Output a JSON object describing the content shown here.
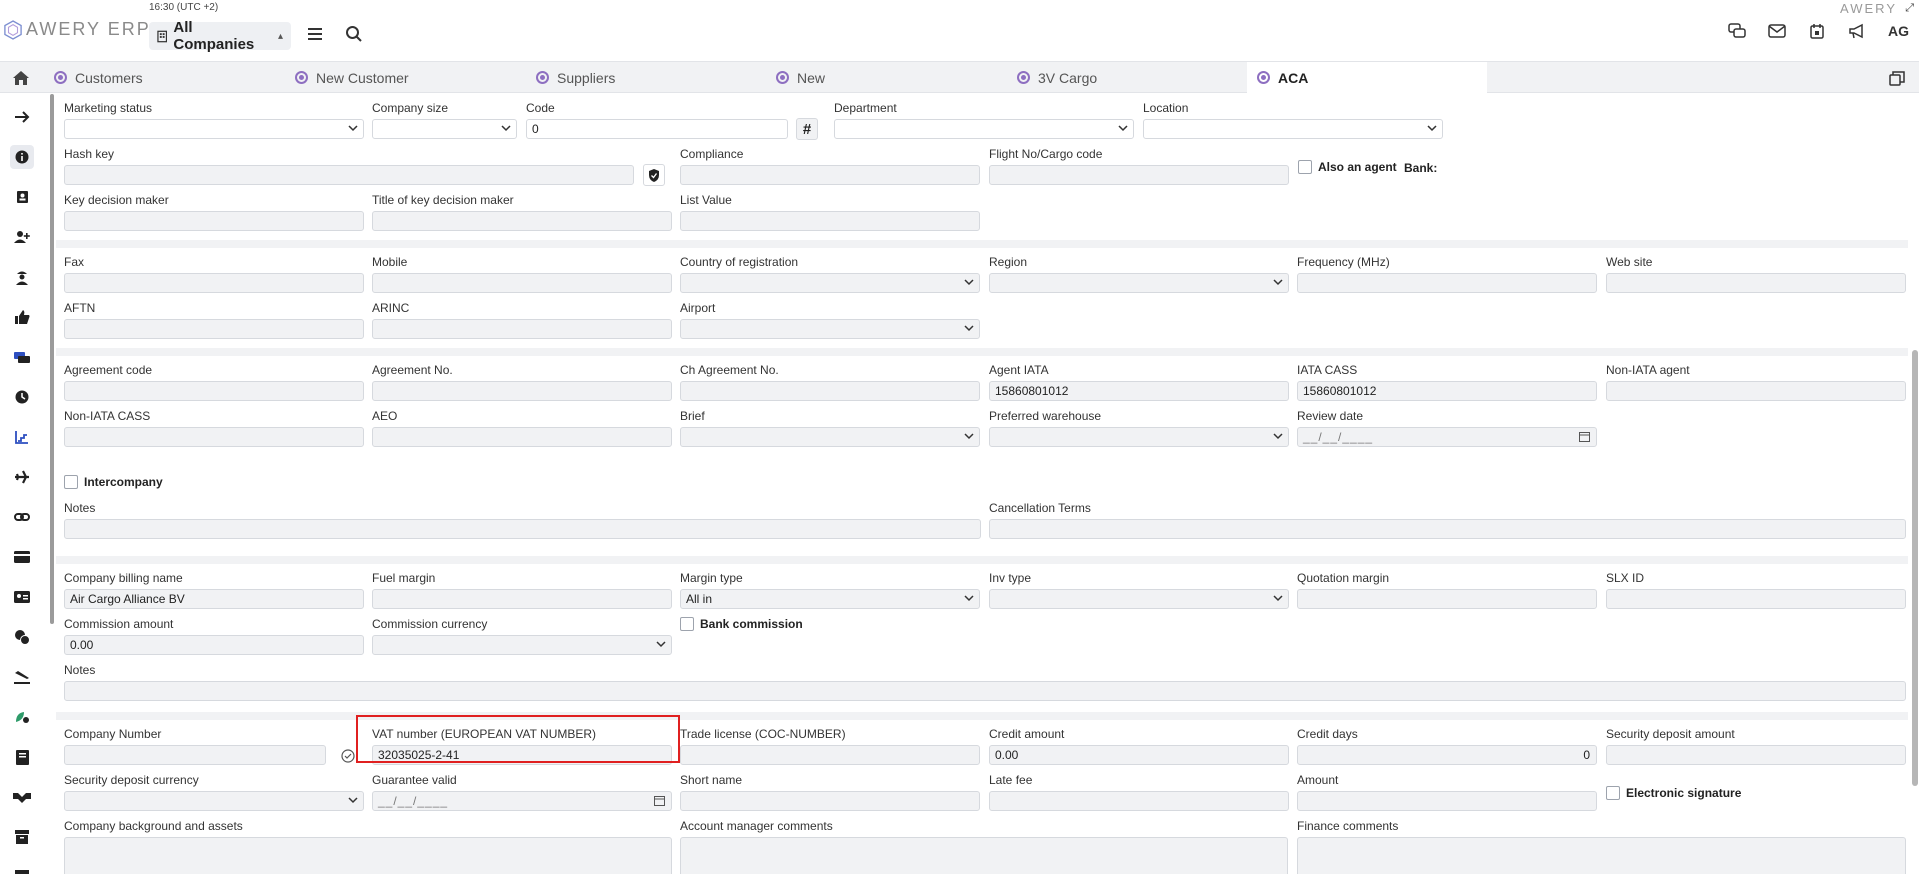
{
  "header": {
    "clock": "16:30 (UTC +2)",
    "logo_text": "AWERY ERP",
    "brand_right": "AWERY",
    "company_select": "All Companies",
    "avatar": "AG"
  },
  "tabs": [
    {
      "label": "Customers"
    },
    {
      "label": "New Customer"
    },
    {
      "label": "Suppliers"
    },
    {
      "label": "New"
    },
    {
      "label": "3V Cargo"
    },
    {
      "label": "ACA"
    }
  ],
  "form": {
    "marketing_status": {
      "label": "Marketing status",
      "value": ""
    },
    "company_size": {
      "label": "Company size",
      "value": ""
    },
    "code": {
      "label": "Code",
      "value": "0"
    },
    "department": {
      "label": "Department",
      "value": ""
    },
    "location": {
      "label": "Location",
      "value": ""
    },
    "hash_key": {
      "label": "Hash key",
      "value": ""
    },
    "compliance": {
      "label": "Compliance",
      "value": ""
    },
    "flight_no": {
      "label": "Flight No/Cargo code",
      "value": ""
    },
    "also_agent": {
      "label": "Also an agent"
    },
    "bank": {
      "label": "Bank:"
    },
    "key_decision_maker": {
      "label": "Key decision maker",
      "value": ""
    },
    "title_key_decision_maker": {
      "label": "Title of key decision maker",
      "value": ""
    },
    "list_value": {
      "label": "List Value",
      "value": ""
    },
    "fax": {
      "label": "Fax",
      "value": ""
    },
    "mobile": {
      "label": "Mobile",
      "value": ""
    },
    "country_registration": {
      "label": "Country of registration",
      "value": ""
    },
    "region": {
      "label": "Region",
      "value": ""
    },
    "frequency": {
      "label": "Frequency (MHz)",
      "value": ""
    },
    "web_site": {
      "label": "Web site",
      "value": ""
    },
    "aftn": {
      "label": "AFTN",
      "value": ""
    },
    "arinc": {
      "label": "ARINC",
      "value": ""
    },
    "airport": {
      "label": "Airport",
      "value": ""
    },
    "agreement_code": {
      "label": "Agreement code",
      "value": ""
    },
    "agreement_no": {
      "label": "Agreement No.",
      "value": ""
    },
    "ch_agreement_no": {
      "label": "Ch Agreement No.",
      "value": ""
    },
    "agent_iata": {
      "label": "Agent IATA",
      "value": "15860801012"
    },
    "iata_cass": {
      "label": "IATA CASS",
      "value": "15860801012"
    },
    "non_iata_agent": {
      "label": "Non-IATA agent",
      "value": ""
    },
    "non_iata_cass": {
      "label": "Non-IATA CASS",
      "value": ""
    },
    "aeo": {
      "label": "AEO",
      "value": ""
    },
    "brief": {
      "label": "Brief",
      "value": ""
    },
    "preferred_warehouse": {
      "label": "Preferred warehouse",
      "value": ""
    },
    "review_date": {
      "label": "Review date",
      "value": "__/__/____"
    },
    "intercompany": {
      "label": "Intercompany"
    },
    "notes1": {
      "label": "Notes",
      "value": ""
    },
    "cancellation_terms": {
      "label": "Cancellation Terms",
      "value": ""
    },
    "company_billing_name": {
      "label": "Company billing name",
      "value": "Air Cargo Alliance BV"
    },
    "fuel_margin": {
      "label": "Fuel margin",
      "value": ""
    },
    "margin_type": {
      "label": "Margin type",
      "value": "All in"
    },
    "inv_type": {
      "label": "Inv type",
      "value": ""
    },
    "quotation_margin": {
      "label": "Quotation margin",
      "value": ""
    },
    "slx_id": {
      "label": "SLX ID",
      "value": ""
    },
    "commission_amount": {
      "label": "Commission amount",
      "value": "0.00"
    },
    "commission_currency": {
      "label": "Commission currency",
      "value": ""
    },
    "bank_commission": {
      "label": "Bank commission"
    },
    "notes2": {
      "label": "Notes",
      "value": ""
    },
    "company_number": {
      "label": "Company Number",
      "value": ""
    },
    "vat_number": {
      "label": "VAT number (EUROPEAN VAT NUMBER)",
      "value": "32035025-2-41"
    },
    "trade_license": {
      "label": "Trade license (COC-NUMBER)",
      "value": ""
    },
    "credit_amount": {
      "label": "Credit amount",
      "value": "0.00"
    },
    "credit_days": {
      "label": "Credit days",
      "value": "0"
    },
    "security_deposit_amount": {
      "label": "Security deposit amount",
      "value": ""
    },
    "security_deposit_currency": {
      "label": "Security deposit currency",
      "value": ""
    },
    "guarantee_valid": {
      "label": "Guarantee valid",
      "value": "__/__/____"
    },
    "short_name": {
      "label": "Short name",
      "value": ""
    },
    "late_fee": {
      "label": "Late fee",
      "value": ""
    },
    "amount": {
      "label": "Amount",
      "value": ""
    },
    "electronic_signature": {
      "label": "Electronic signature"
    },
    "company_background": {
      "label": "Company background and assets",
      "value": ""
    },
    "account_manager_comments": {
      "label": "Account manager comments",
      "value": ""
    },
    "finance_comments": {
      "label": "Finance comments",
      "value": ""
    }
  },
  "colors": {
    "tab_dot": "#8e6fc1",
    "highlight": "#e02020",
    "field_bg": "#f1f2f4"
  }
}
